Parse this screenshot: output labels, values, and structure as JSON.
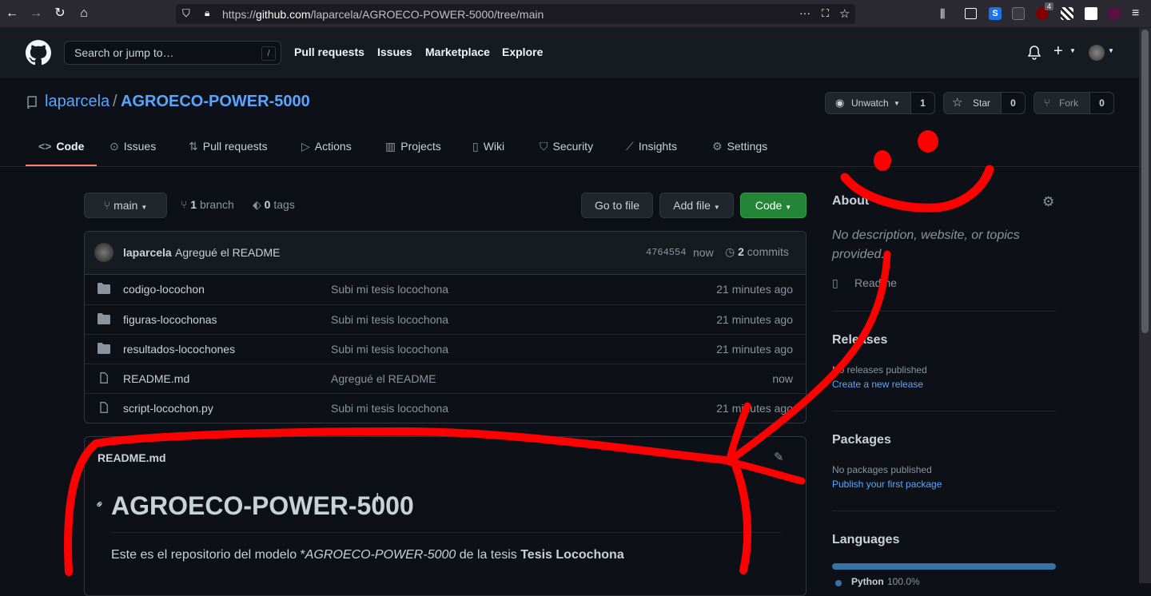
{
  "browser": {
    "url_prefix": "https://",
    "url_domain": "github.com",
    "url_path": "/laparcela/AGROECO-POWER-5000/tree/main",
    "ext_badge": "4"
  },
  "header": {
    "search_placeholder": "Search or jump to…",
    "search_shortcut": "/",
    "nav": [
      "Pull requests",
      "Issues",
      "Marketplace",
      "Explore"
    ]
  },
  "repo": {
    "owner": "laparcela",
    "sep": "/",
    "name": "AGROECO-POWER-5000",
    "watch_label": "Unwatch",
    "watch_count": "1",
    "star_label": "Star",
    "star_count": "0",
    "fork_label": "Fork",
    "fork_count": "0"
  },
  "tabs": [
    {
      "label": "Code",
      "icon": "code-icon"
    },
    {
      "label": "Issues",
      "icon": "issue-icon"
    },
    {
      "label": "Pull requests",
      "icon": "pull-request-icon"
    },
    {
      "label": "Actions",
      "icon": "play-icon"
    },
    {
      "label": "Projects",
      "icon": "project-icon"
    },
    {
      "label": "Wiki",
      "icon": "book-icon"
    },
    {
      "label": "Security",
      "icon": "shield-icon"
    },
    {
      "label": "Insights",
      "icon": "graph-icon"
    },
    {
      "label": "Settings",
      "icon": "gear-icon"
    }
  ],
  "filenav": {
    "branch": "main",
    "branch_count": "1",
    "branch_word": "branch",
    "tag_count": "0",
    "tag_word": "tags",
    "go_to_file": "Go to file",
    "add_file": "Add file",
    "code": "Code"
  },
  "commit": {
    "author": "laparcela",
    "message": "Agregué el README",
    "sha": "4764554",
    "time": "now",
    "count": "2",
    "count_word": "commits"
  },
  "files": [
    {
      "name": "codigo-locochon",
      "type": "dir",
      "message": "Subi mi tesis locochona",
      "age": "21 minutes ago"
    },
    {
      "name": "figuras-locochonas",
      "type": "dir",
      "message": "Subi mi tesis locochona",
      "age": "21 minutes ago"
    },
    {
      "name": "resultados-locochones",
      "type": "dir",
      "message": "Subi mi tesis locochona",
      "age": "21 minutes ago"
    },
    {
      "name": "README.md",
      "type": "file",
      "message": "Agregué el README",
      "age": "now"
    },
    {
      "name": "script-locochon.py",
      "type": "file",
      "message": "Subi mi tesis locochona",
      "age": "21 minutes ago"
    }
  ],
  "readme": {
    "filename": "README.md",
    "heading": "AGROECO-POWER-5000",
    "para_start": "Este es el repositorio del modelo *",
    "para_em": "AGROECO-POWER-5000",
    "para_mid": " de la tesis ",
    "para_strong": "Tesis Locochona"
  },
  "sidebar": {
    "about_title": "About",
    "about_desc": "No description, website, or topics provided.",
    "readme_link": "Readme",
    "releases_title": "Releases",
    "releases_none": "No releases published",
    "releases_link": "Create a new release",
    "packages_title": "Packages",
    "packages_none": "No packages published",
    "packages_link": "Publish your first package",
    "languages_title": "Languages",
    "language_name": "Python",
    "language_pct": "100.0%"
  },
  "colors": {
    "accent_link": "#58a6ff",
    "code_button": "#238636",
    "tab_underline": "#f78166",
    "python": "#3572A5",
    "annotation": "#ff0000"
  }
}
